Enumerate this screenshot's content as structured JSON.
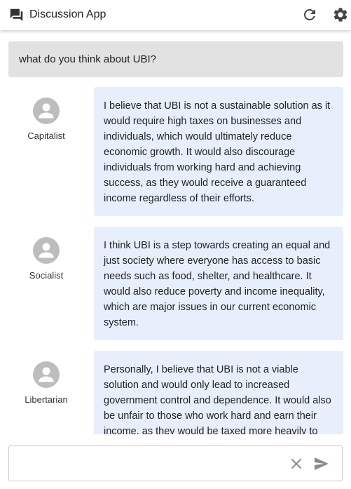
{
  "header": {
    "title": "Discussion App",
    "app_icon": "forum-icon",
    "refresh_icon": "refresh-icon",
    "settings_icon": "gear-icon"
  },
  "prompt": {
    "text": "what do you think about UBI?"
  },
  "messages": [
    {
      "role": "Capitalist",
      "text": "I believe that UBI is not a sustainable solution as it would require high taxes on businesses and individuals, which would ultimately reduce economic growth. It would also discourage individuals from working hard and achieving success, as they would receive a guaranteed income regardless of their efforts."
    },
    {
      "role": "Socialist",
      "text": "I think UBI is a step towards creating an equal and just society where everyone has access to basic needs such as food, shelter, and healthcare. It would also reduce poverty and income inequality, which are major issues in our current economic system."
    },
    {
      "role": "Libertarian",
      "text": "Personally, I believe that UBI is not a viable solution and would only lead to increased government control and dependence. It would also be unfair to those who work hard and earn their income, as they would be taxed more heavily to support those who"
    }
  ],
  "input": {
    "value": "",
    "placeholder": "",
    "clear_icon": "close-icon",
    "send_icon": "send-icon"
  },
  "colors": {
    "bubble": "#e8effc",
    "prompt_bg": "#e2e2e2",
    "avatar": "#bdbdbd",
    "icon": "#3d3d3d"
  }
}
